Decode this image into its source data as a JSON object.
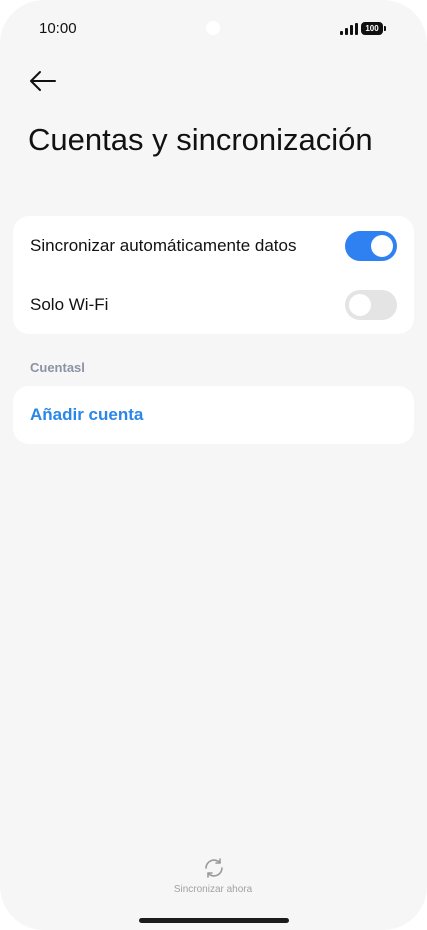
{
  "status_bar": {
    "time": "10:00",
    "battery": "100"
  },
  "header": {
    "back_icon": "arrow-left-icon",
    "title": "Cuentas y sincronización"
  },
  "sync_settings": {
    "auto_sync": {
      "label": "Sincronizar automáticamente datos",
      "enabled": true
    },
    "wifi_only": {
      "label": "Solo Wi-Fi",
      "enabled": false
    }
  },
  "accounts_section": {
    "label": "Cuentasl",
    "add_account_label": "Añadir cuenta"
  },
  "footer": {
    "sync_icon": "refresh-icon",
    "sync_now_label": "Sincronizar ahora"
  },
  "colors": {
    "accent": "#2f80f0",
    "link": "#2a86e8",
    "background": "#f6f6f6",
    "toggle_off": "#e4e4e4"
  }
}
